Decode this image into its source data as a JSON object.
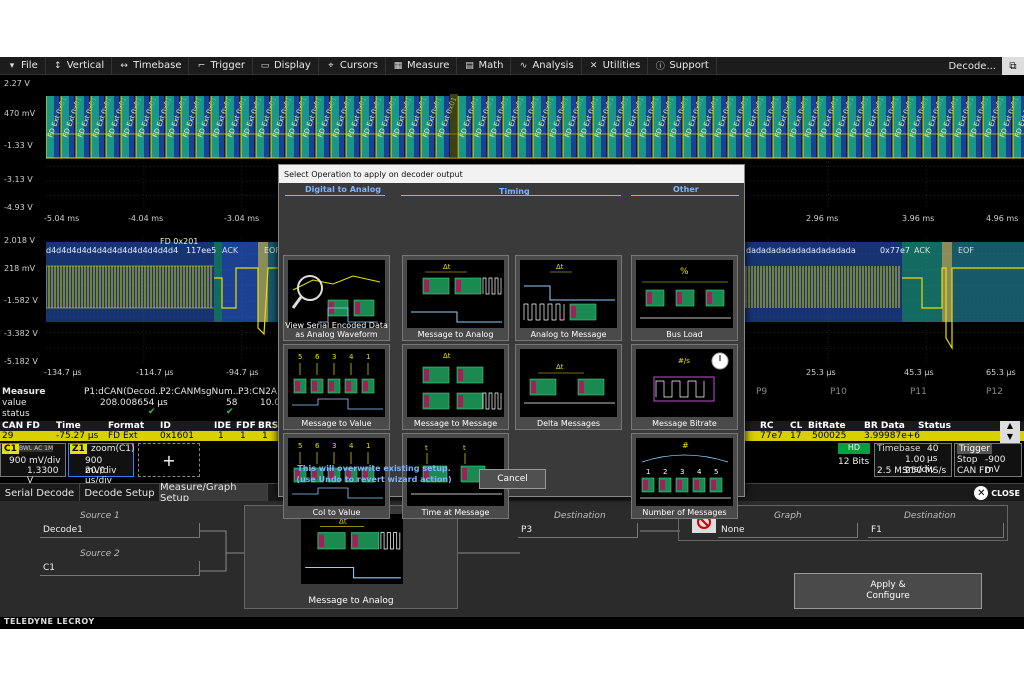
{
  "menu": {
    "items": [
      {
        "label": "File",
        "icon": "arrow-down-icon"
      },
      {
        "label": "Vertical",
        "icon": "vertical-arrows-icon"
      },
      {
        "label": "Timebase",
        "icon": "horizontal-arrows-icon"
      },
      {
        "label": "Trigger",
        "icon": "trigger-icon"
      },
      {
        "label": "Display",
        "icon": "display-icon"
      },
      {
        "label": "Cursors",
        "icon": "cursor-icon"
      },
      {
        "label": "Measure",
        "icon": "measure-icon"
      },
      {
        "label": "Math",
        "icon": "math-icon"
      },
      {
        "label": "Analysis",
        "icon": "analysis-icon"
      },
      {
        "label": "Utilities",
        "icon": "tools-icon"
      },
      {
        "label": "Support",
        "icon": "info-icon"
      }
    ],
    "right_label": "Decode..."
  },
  "top_pane": {
    "y_labels": [
      "2.27 V",
      "470 mV",
      "-1.33 V",
      "-3.13 V",
      "-4.93 V"
    ],
    "x_labels": [
      "-5.04 ms",
      "-4.04 ms",
      "-3.04 ms",
      "2.96 ms",
      "3.96 ms",
      "4.96 ms"
    ]
  },
  "zoom_pane": {
    "y_labels": [
      "2.018 V",
      "218 mV",
      "-1.582 V",
      "-3.382 V",
      "-5.182 V"
    ],
    "x_labels": [
      "-134.7 µs",
      "-114.7 µs",
      "-94.7 µs",
      "25.3 µs",
      "45.3 µs",
      "65.3 µs"
    ],
    "left_frame_label": "FD 0x201",
    "data_text": "d4d4d4d4d4d4d4d4d4d4d4d4d4",
    "crc_label": "117ee5",
    "right_data_text": "dadadadadadadadadadada",
    "right_crc_label": "0x77e7",
    "ack": "ACK",
    "eof": "EOF"
  },
  "measure": {
    "header": "Measure",
    "row_value": "value",
    "row_status": "status",
    "p1_name": "P1:dCAN(Decod...",
    "p1_value": "208.008654 µs",
    "p2_name": "P2:CANMsgNum...",
    "p2_value": "58",
    "p3_name": "P3:CN2AN",
    "p3_value": "10.0",
    "p9": "P9",
    "p10": "P10",
    "p11": "P11",
    "p12": "P12"
  },
  "decode_table": {
    "headers": [
      "CAN FD",
      "Time",
      "Format",
      "ID",
      "IDE",
      "FDF",
      "BRS",
      "RC",
      "CL",
      "BitRate",
      "BR Data",
      "Status"
    ],
    "row": [
      "29",
      "-75.27 µs",
      "FD Ext",
      "0x1601",
      "1",
      "1",
      "1",
      "77e7",
      "17",
      "500025",
      "3.99987e+6",
      ""
    ]
  },
  "channels": {
    "c1_label": "C1",
    "c1_tags": "BWL  AC 1M",
    "c1_vdiv": "900 mV/div",
    "c1_offset": "1.3300 V",
    "z1_label": "Z1",
    "z1_name": "zoom(C1)",
    "z1_vdiv": "900 mV/div",
    "z1_tdiv": "20.0 µs/div",
    "add_symbol": "+"
  },
  "status_right": {
    "hd": "HD",
    "bits": "12 Bits",
    "timebase_label": "Timebase",
    "timebase_value": "40 µs",
    "tdiv": "1.00 ms/div",
    "samples": "2.5 MS",
    "rate": "250 MS/s",
    "trigger_label": "Trigger",
    "trigger_mode": "Stop",
    "trigger_level": "-900 mV",
    "trigger_type": "CAN FD"
  },
  "tabs": [
    {
      "label": "Serial Decode"
    },
    {
      "label": "Decode Setup"
    },
    {
      "label": "Measure/Graph Setup"
    }
  ],
  "close_label": "CLOSE",
  "panel": {
    "source1_label": "Source 1",
    "source1_value": "Decode1",
    "source2_label": "Source 2",
    "source2_value": "C1",
    "selected_op": "Message to Analog",
    "destination_label": "Destination",
    "destination_value": "P3",
    "graph_label": "Graph",
    "graph_value": "None",
    "graph_dest_label": "Destination",
    "graph_dest_value": "F1",
    "apply_label_1": "Apply &",
    "apply_label_2": "Configure"
  },
  "brand": "TELEDYNE LECROY",
  "dialog": {
    "title": "Select Operation to apply on decoder output",
    "cat_digital": "Digital to Analog",
    "cat_timing": "Timing",
    "cat_other": "Other",
    "ops": {
      "view_serial_1": "View Serial Encoded Data",
      "view_serial_2": "as Analog Waveform",
      "msg_to_analog": "Message to Analog",
      "analog_to_msg": "Analog to Message",
      "bus_load": "Bus Load",
      "msg_to_value": "Message to Value",
      "msg_to_msg": "Message to Message",
      "delta_msgs": "Delta Messages",
      "msg_bitrate": "Message Bitrate",
      "col_to_value": "Col to Value",
      "time_at_msg": "Time at Message",
      "num_msgs": "Number of Messages"
    },
    "thumb_text": {
      "delta_t": "Δt",
      "t": "t",
      "percent": "%",
      "hash": "#",
      "bits_per_s": "#/s",
      "values": [
        "5",
        "6",
        "3",
        "4",
        "1"
      ],
      "counts": [
        "1",
        "2",
        "3",
        "4",
        "5"
      ]
    },
    "warning_1": "This will overwrite existing setup.",
    "warning_2": "(use Undo to revert wizard action)",
    "cancel": "Cancel"
  },
  "colors": {
    "trace": "#e8e000",
    "decode_fill": "#1fb0a0",
    "decode_blue": "#2050c0",
    "accent_blue": "#7fb2ff",
    "row_yellow": "#d8d000"
  }
}
